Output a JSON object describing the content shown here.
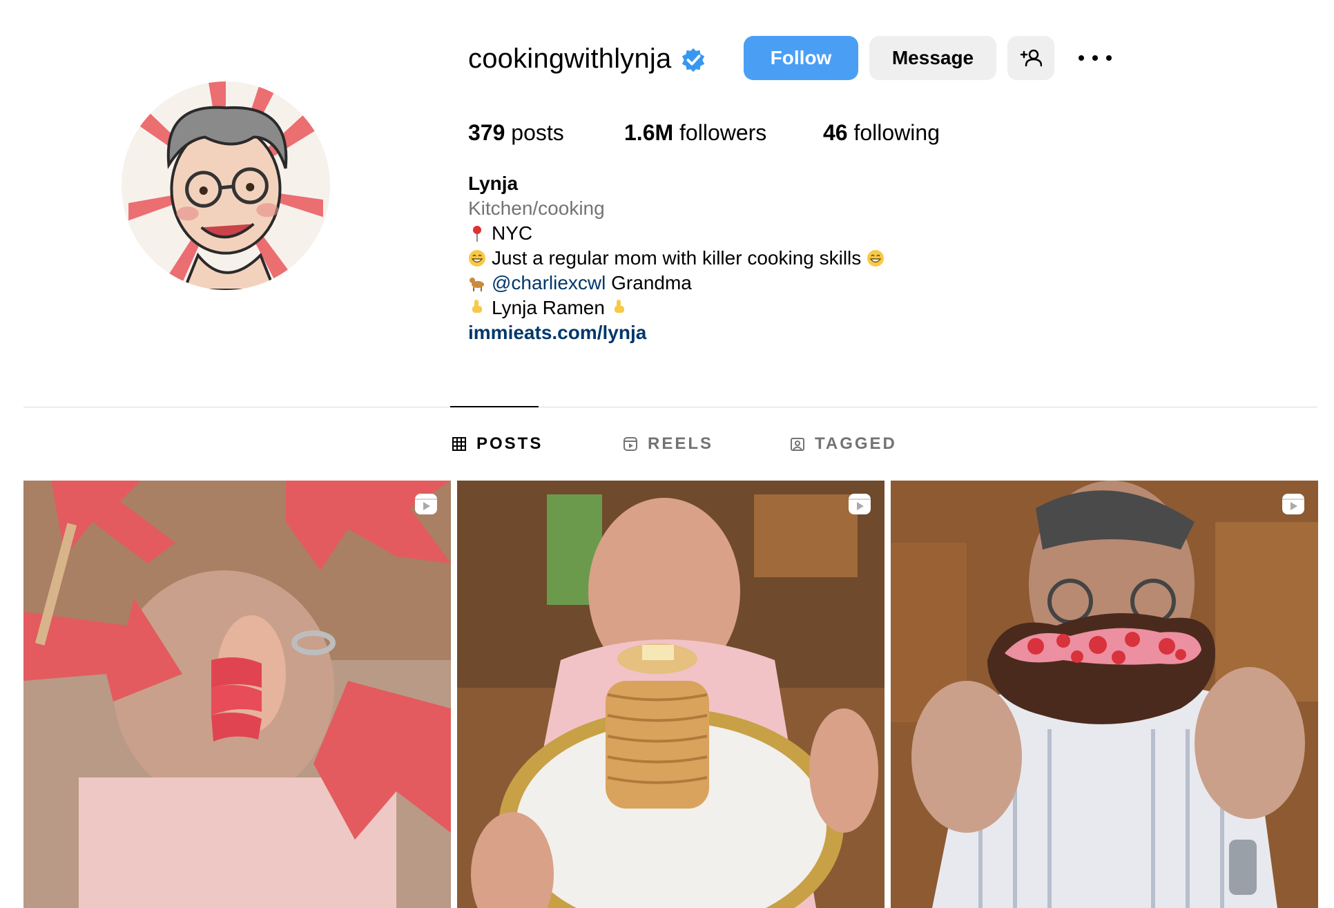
{
  "profile": {
    "username": "cookingwithlynja",
    "verified": true,
    "buttons": {
      "follow": "Follow",
      "message": "Message",
      "add_user_icon": "person-plus-icon",
      "more_icon": "ellipsis-icon"
    },
    "stats": {
      "posts_count": "379",
      "posts_label": "posts",
      "followers_count": "1.6M",
      "followers_label": "followers",
      "following_count": "46",
      "following_label": "following"
    },
    "bio": {
      "name": "Lynja",
      "category": "Kitchen/cooking",
      "location": "NYC",
      "tagline": "Just a regular mom with killer cooking skills",
      "mention": "@charliexcwl",
      "mention_suffix": "Grandma",
      "ramen": "Lynja Ramen",
      "link": "immieats.com/lynja"
    }
  },
  "tabs": [
    {
      "label": "POSTS",
      "icon": "grid-icon",
      "active": true
    },
    {
      "label": "REELS",
      "icon": "reels-icon",
      "active": false
    },
    {
      "label": "TAGGED",
      "icon": "tagged-icon",
      "active": false
    }
  ],
  "posts": [
    {
      "type": "reel",
      "icon": "reel-icon"
    },
    {
      "type": "reel",
      "icon": "reel-icon"
    },
    {
      "type": "reel",
      "icon": "reel-icon"
    }
  ],
  "colors": {
    "follow_button": "#4a9ff5",
    "secondary_button": "#efefef",
    "link": "#00376b",
    "muted": "#737373",
    "verified": "#3897f0"
  }
}
